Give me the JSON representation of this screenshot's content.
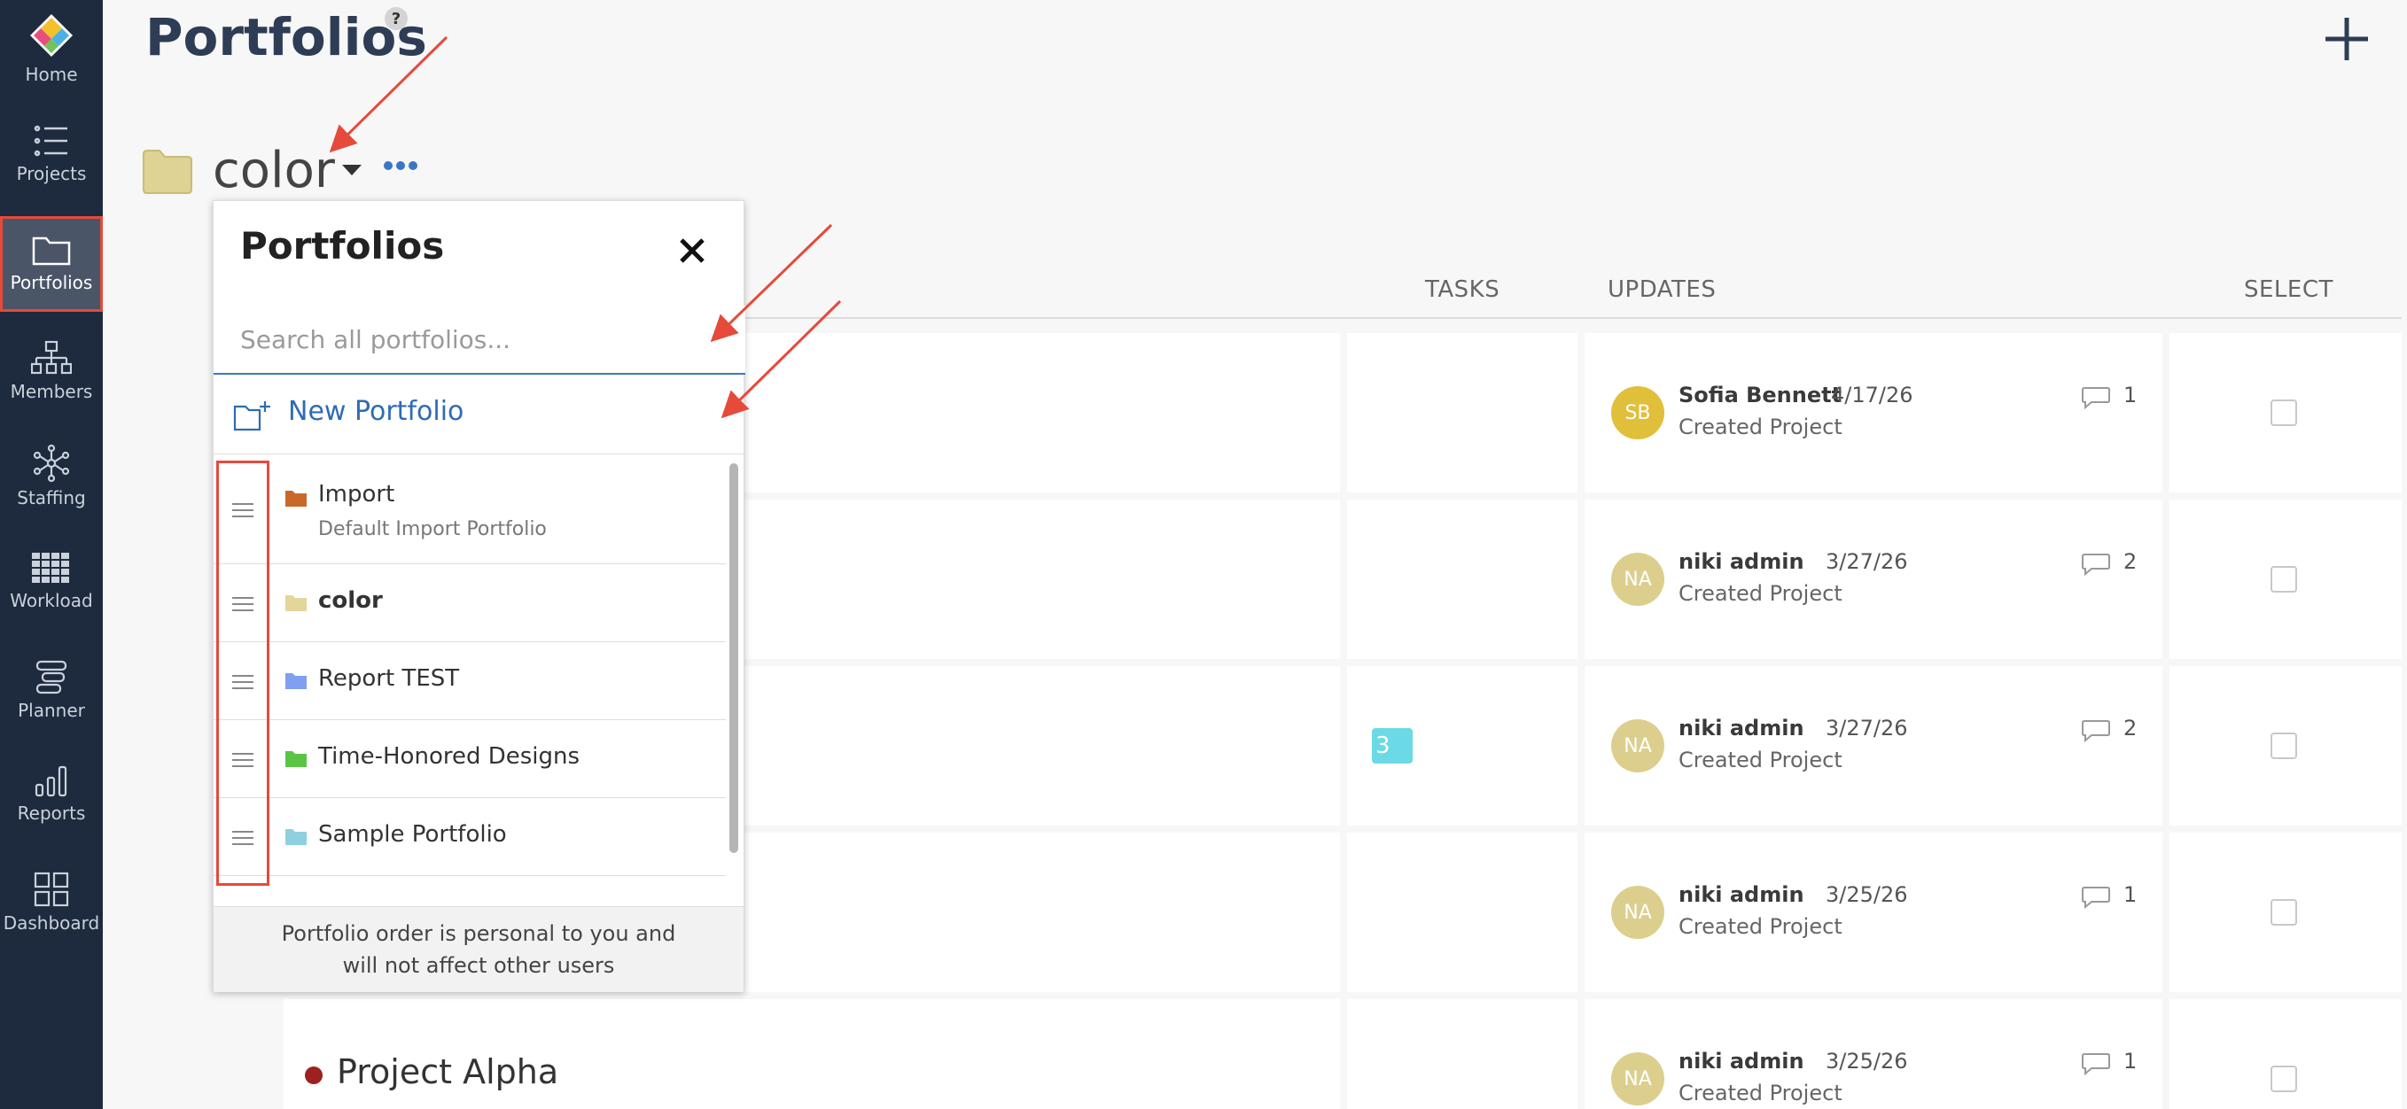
{
  "sidebar": {
    "items": [
      {
        "label": "Home",
        "icon": "logo-icon"
      },
      {
        "label": "Projects",
        "icon": "list-icon"
      },
      {
        "label": "Portfolios",
        "icon": "folder-icon",
        "active": true
      },
      {
        "label": "Members",
        "icon": "org-chart-icon"
      },
      {
        "label": "Staffing",
        "icon": "network-icon"
      },
      {
        "label": "Workload",
        "icon": "grid-icon"
      },
      {
        "label": "Planner",
        "icon": "planner-icon"
      },
      {
        "label": "Reports",
        "icon": "bar-chart-icon"
      },
      {
        "label": "Dashboard",
        "icon": "dashboard-icon"
      }
    ]
  },
  "header": {
    "title": "Portfolios",
    "help": "?",
    "portfolio_name": "color"
  },
  "table": {
    "columns": {
      "tasks": "TASKS",
      "updates": "UPDATES",
      "select": "SELECT"
    },
    "rows": [
      {
        "initials": "SB",
        "avatar_color": "#e0bf3a",
        "user": "Sofia Bennett",
        "date": "4/17/26",
        "action": "Created Project",
        "comments": "1"
      },
      {
        "initials": "NA",
        "avatar_color": "#dccf8e",
        "user": "niki admin",
        "date": "3/27/26",
        "action": "Created Project",
        "comments": "2"
      },
      {
        "initials": "NA",
        "avatar_color": "#dccf8e",
        "user": "niki admin",
        "date": "3/27/26",
        "action": "Created Project",
        "comments": "2",
        "tasks": "3"
      },
      {
        "initials": "NA",
        "avatar_color": "#dccf8e",
        "user": "niki admin",
        "date": "3/25/26",
        "action": "Created Project",
        "comments": "1"
      },
      {
        "initials": "NA",
        "avatar_color": "#dccf8e",
        "user": "niki admin",
        "date": "3/25/26",
        "action": "Created Project",
        "comments": "1",
        "project": "Project Alpha"
      }
    ]
  },
  "dropdown": {
    "title": "Portfolios",
    "search_placeholder": "Search all portfolios...",
    "new_label": "New Portfolio",
    "items": [
      {
        "name": "Import",
        "subtitle": "Default Import Portfolio",
        "color": "#c8692a"
      },
      {
        "name": "color",
        "color": "#e4d69a",
        "bold": true
      },
      {
        "name": "Report TEST",
        "color": "#7f9ff0"
      },
      {
        "name": "Time-Honored Designs",
        "color": "#5cc445"
      },
      {
        "name": "Sample Portfolio",
        "color": "#8fd0e0"
      }
    ],
    "footer_line1": "Portfolio order is personal to you and",
    "footer_line2": "will not affect other users"
  },
  "colors": {
    "sidebar": "#1e2a3d",
    "accent": "#2f6bb4",
    "annotation": "#e64a3b"
  }
}
